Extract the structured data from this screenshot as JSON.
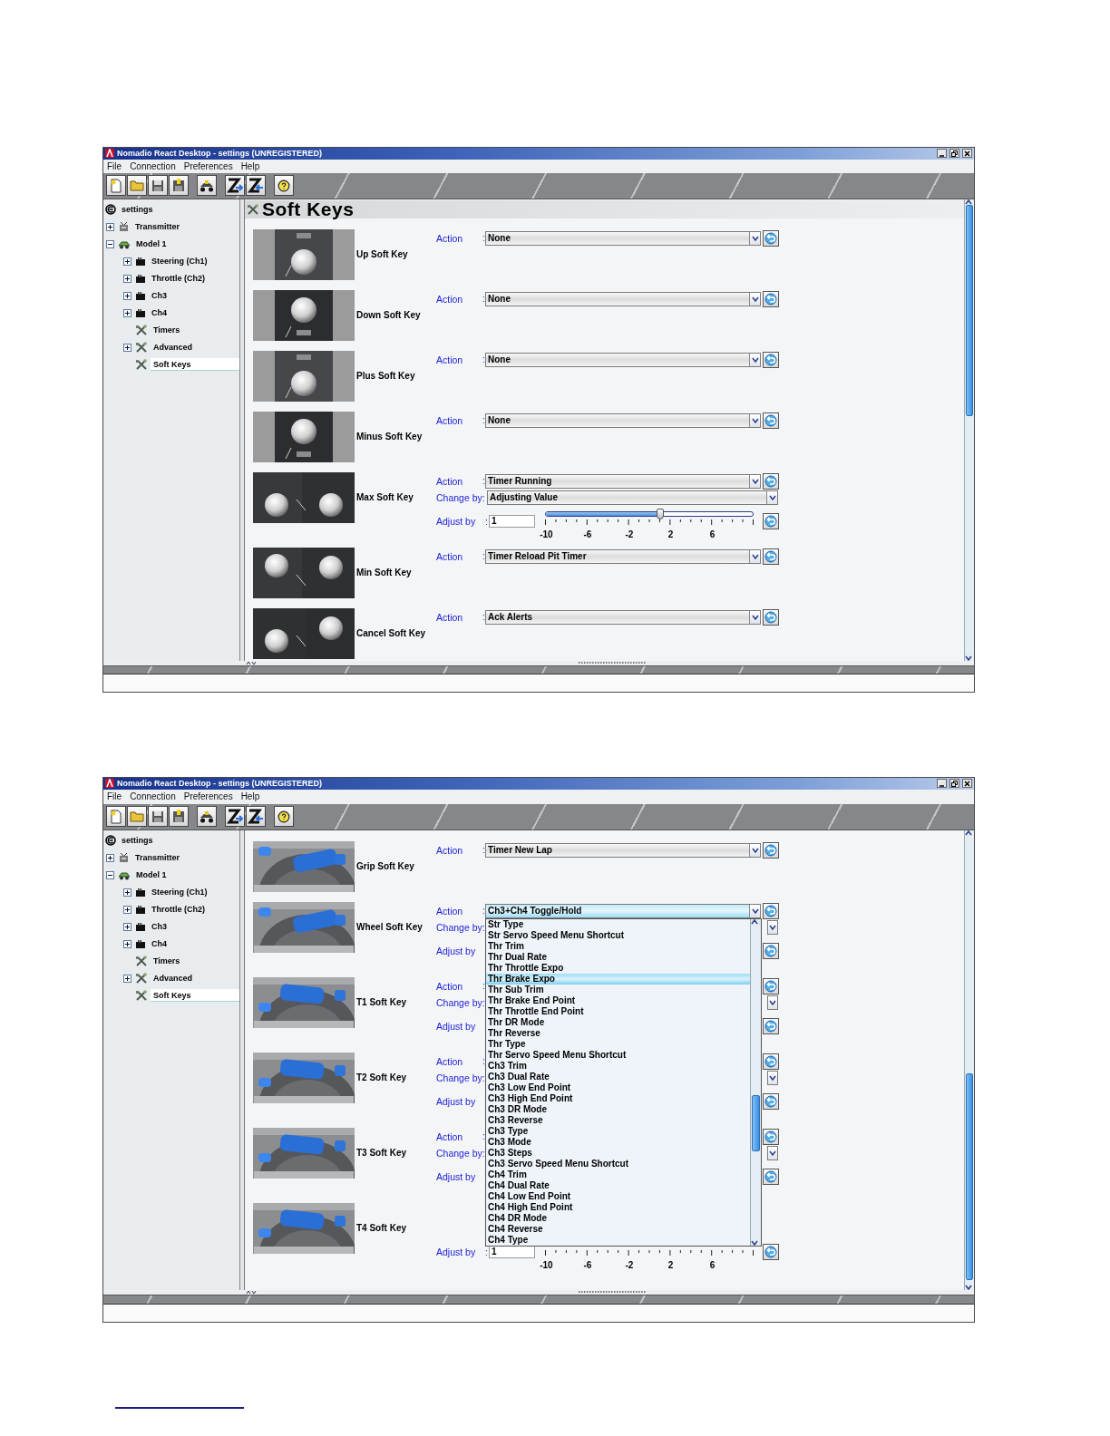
{
  "windows": [
    {
      "title": "Nomadio React Desktop - settings (UNREGISTERED)",
      "menu": [
        "File",
        "Connection",
        "Preferences",
        "Help"
      ],
      "tree": {
        "label": "settings",
        "children": [
          {
            "label": "Transmitter",
            "kind": "transmitter",
            "expanded": false,
            "selected": false
          },
          {
            "label": "Model 1",
            "kind": "model",
            "expanded": true,
            "selected": false,
            "children": [
              {
                "label": "Steering (Ch1)",
                "kind": "channel",
                "expanded": false,
                "selected": false
              },
              {
                "label": "Throttle (Ch2)",
                "kind": "channel",
                "expanded": false,
                "selected": false
              },
              {
                "label": "Ch3",
                "kind": "channel",
                "expanded": false,
                "selected": false
              },
              {
                "label": "Ch4",
                "kind": "channel",
                "expanded": false,
                "selected": false
              },
              {
                "label": "Timers",
                "kind": "tool",
                "selected": false
              },
              {
                "label": "Advanced",
                "kind": "tool",
                "expanded": false,
                "selected": false
              },
              {
                "label": "Soft Keys",
                "kind": "tool",
                "selected": true
              }
            ]
          }
        ]
      },
      "panel": {
        "heading": "Soft Keys",
        "keys": [
          {
            "name": "Up Soft Key",
            "action": {
              "label": "Action",
              "colon": ":",
              "value": "None"
            }
          },
          {
            "name": "Down Soft Key",
            "action": {
              "label": "Action",
              "colon": ":",
              "value": "None"
            }
          },
          {
            "name": "Plus Soft Key",
            "action": {
              "label": "Action",
              "colon": ":",
              "value": "None"
            }
          },
          {
            "name": "Minus Soft Key",
            "action": {
              "label": "Action",
              "colon": ":",
              "value": "None"
            }
          },
          {
            "name": "Max Soft Key",
            "action": {
              "label": "Action",
              "colon": ":",
              "value": "Timer Running"
            },
            "change_by": {
              "label": "Change by:",
              "value": "Adjusting Value"
            },
            "adjust_by": {
              "label": "Adjust by",
              "colon": ":",
              "value": "1",
              "level": 0.55,
              "tick_labels": [
                "-10",
                "-6",
                "-2",
                "2",
                "6"
              ]
            }
          },
          {
            "name": "Min Soft Key",
            "action": {
              "label": "Action",
              "colon": ":",
              "value": "Timer Reload Pit Timer"
            }
          },
          {
            "name": "Cancel Soft Key",
            "action": {
              "label": "Action",
              "colon": ":",
              "value": "Ack Alerts"
            }
          }
        ]
      }
    },
    {
      "title": "Nomadio React Desktop - settings (UNREGISTERED)",
      "menu": [
        "File",
        "Connection",
        "Preferences",
        "Help"
      ],
      "tree": {
        "label": "settings",
        "children": [
          {
            "label": "Transmitter",
            "kind": "transmitter",
            "expanded": false,
            "selected": false
          },
          {
            "label": "Model 1",
            "kind": "model",
            "expanded": true,
            "selected": false,
            "children": [
              {
                "label": "Steering (Ch1)",
                "kind": "channel",
                "expanded": false,
                "selected": false
              },
              {
                "label": "Throttle (Ch2)",
                "kind": "channel",
                "expanded": false,
                "selected": false
              },
              {
                "label": "Ch3",
                "kind": "channel",
                "expanded": false,
                "selected": false
              },
              {
                "label": "Ch4",
                "kind": "channel",
                "expanded": false,
                "selected": false
              },
              {
                "label": "Timers",
                "kind": "tool",
                "selected": false
              },
              {
                "label": "Advanced",
                "kind": "tool",
                "expanded": false,
                "selected": false
              },
              {
                "label": "Soft Keys",
                "kind": "tool",
                "selected": true
              }
            ]
          }
        ]
      },
      "panel": {
        "keys": [
          {
            "name": "Grip Soft Key",
            "action": {
              "label": "Action",
              "colon": ":",
              "value": "Timer New Lap"
            }
          },
          {
            "name": "Wheel Soft Key",
            "action": {
              "label": "Action",
              "colon": ":",
              "value": "Ch3+Ch4 Toggle/Hold",
              "open": true,
              "options": [
                {
                  "label": "Str Type",
                  "selected": false
                },
                {
                  "label": "Str Servo Speed Menu Shortcut",
                  "selected": false
                },
                {
                  "label": "Thr Trim",
                  "selected": false
                },
                {
                  "label": "Thr Dual Rate",
                  "selected": false
                },
                {
                  "label": "Thr Throttle Expo",
                  "selected": false
                },
                {
                  "label": "Thr Brake Expo",
                  "selected": true
                },
                {
                  "label": "Thr Sub Trim",
                  "selected": false
                },
                {
                  "label": "Thr Brake End Point",
                  "selected": false
                },
                {
                  "label": "Thr Throttle End Point",
                  "selected": false
                },
                {
                  "label": "Thr DR Mode",
                  "selected": false
                },
                {
                  "label": "Thr Reverse",
                  "selected": false
                },
                {
                  "label": "Thr Type",
                  "selected": false
                },
                {
                  "label": "Thr Servo Speed Menu Shortcut",
                  "selected": false
                },
                {
                  "label": "Ch3 Trim",
                  "selected": false
                },
                {
                  "label": "Ch3 Dual Rate",
                  "selected": false
                },
                {
                  "label": "Ch3 Low End Point",
                  "selected": false
                },
                {
                  "label": "Ch3 High End Point",
                  "selected": false
                },
                {
                  "label": "Ch3 DR Mode",
                  "selected": false
                },
                {
                  "label": "Ch3 Reverse",
                  "selected": false
                },
                {
                  "label": "Ch3 Type",
                  "selected": false
                },
                {
                  "label": "Ch3 Mode",
                  "selected": false
                },
                {
                  "label": "Ch3 Steps",
                  "selected": false
                },
                {
                  "label": "Ch3 Servo Speed Menu Shortcut",
                  "selected": false
                },
                {
                  "label": "Ch4 Trim",
                  "selected": false
                },
                {
                  "label": "Ch4 Dual Rate",
                  "selected": false
                },
                {
                  "label": "Ch4 Low End Point",
                  "selected": false
                },
                {
                  "label": "Ch4 High End Point",
                  "selected": false
                },
                {
                  "label": "Ch4 DR Mode",
                  "selected": false
                },
                {
                  "label": "Ch4 Reverse",
                  "selected": false
                },
                {
                  "label": "Ch4 Type",
                  "selected": false
                }
              ]
            },
            "change_by": {
              "label": "Change by:"
            },
            "adjust_by": {
              "label": "Adjust by"
            }
          },
          {
            "name": "T1 Soft Key",
            "action": {
              "label": "Action",
              "colon": ":"
            },
            "change_by": {
              "label": "Change by:"
            },
            "adjust_by": {
              "label": "Adjust by"
            }
          },
          {
            "name": "T2 Soft Key",
            "action": {
              "label": "Action",
              "colon": ":"
            },
            "change_by": {
              "label": "Change by:"
            },
            "adjust_by": {
              "label": "Adjust by"
            }
          },
          {
            "name": "T3 Soft Key",
            "action": {
              "label": "Action",
              "colon": ":"
            },
            "change_by": {
              "label": "Change by:"
            },
            "adjust_by": {
              "label": "Adjust by"
            }
          },
          {
            "name": "T4 Soft Key",
            "adjust_by": {
              "label": "Adjust by",
              "colon": ":",
              "value": "1",
              "tick_labels": [
                "-10",
                "-6",
                "-2",
                "2",
                "6"
              ]
            }
          }
        ]
      }
    }
  ]
}
